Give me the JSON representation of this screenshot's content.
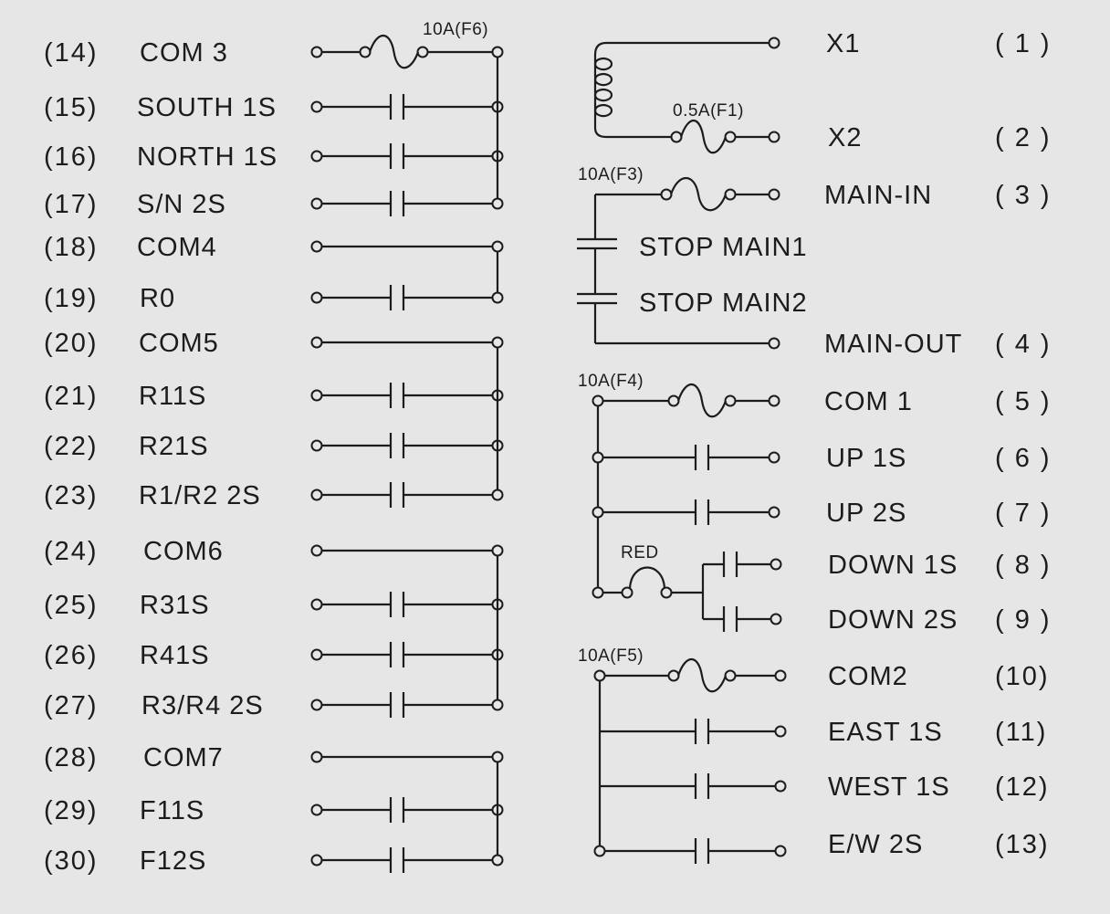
{
  "colors": {
    "background": "#e6e6e6",
    "ink": "#1c1c1c"
  },
  "left": {
    "fuse_label": "10A(F6)",
    "rows": [
      {
        "num": "(14)",
        "label": "COM 3",
        "kind": "fuse"
      },
      {
        "num": "(15)",
        "label": "SOUTH 1S",
        "kind": "contact"
      },
      {
        "num": "(16)",
        "label": "NORTH 1S",
        "kind": "contact"
      },
      {
        "num": "(17)",
        "label": "S/N 2S",
        "kind": "contact"
      },
      {
        "num": "(18)",
        "label": "COM4",
        "kind": "line"
      },
      {
        "num": "(19)",
        "label": "R0",
        "kind": "contact"
      },
      {
        "num": "(20)",
        "label": "COM5",
        "kind": "line"
      },
      {
        "num": "(21)",
        "label": "R11S",
        "kind": "contact"
      },
      {
        "num": "(22)",
        "label": "R21S",
        "kind": "contact"
      },
      {
        "num": "(23)",
        "label": "R1/R2 2S",
        "kind": "contact"
      },
      {
        "num": "(24)",
        "label": "COM6",
        "kind": "line"
      },
      {
        "num": "(25)",
        "label": "R31S",
        "kind": "contact"
      },
      {
        "num": "(26)",
        "label": "R41S",
        "kind": "contact"
      },
      {
        "num": "(27)",
        "label": "R3/R4 2S",
        "kind": "contact"
      },
      {
        "num": "(28)",
        "label": "COM7",
        "kind": "line"
      },
      {
        "num": "(29)",
        "label": "F11S",
        "kind": "contact"
      },
      {
        "num": "(30)",
        "label": "F12S",
        "kind": "contact"
      }
    ]
  },
  "right": {
    "fuse_labels": {
      "f1": "0.5A(F1)",
      "f3": "10A(F3)",
      "f4": "10A(F4)",
      "f5": "10A(F5)"
    },
    "red_label": "RED",
    "stop_labels": [
      "STOP MAIN1",
      "STOP MAIN2"
    ],
    "rows": [
      {
        "num": "( 1 )",
        "label": "X1"
      },
      {
        "num": "( 2 )",
        "label": "X2"
      },
      {
        "num": "( 3 )",
        "label": "MAIN-IN"
      },
      {
        "num": "( 4 )",
        "label": "MAIN-OUT"
      },
      {
        "num": "( 5 )",
        "label": "COM 1"
      },
      {
        "num": "( 6 )",
        "label": "UP  1S"
      },
      {
        "num": "( 7 )",
        "label": "UP  2S"
      },
      {
        "num": "( 8 )",
        "label": "DOWN 1S"
      },
      {
        "num": "( 9 )",
        "label": "DOWN 2S"
      },
      {
        "num": "(10)",
        "label": "COM2"
      },
      {
        "num": "(11)",
        "label": "EAST 1S"
      },
      {
        "num": "(12)",
        "label": "WEST 1S"
      },
      {
        "num": "(13)",
        "label": "E/W 2S"
      }
    ]
  }
}
